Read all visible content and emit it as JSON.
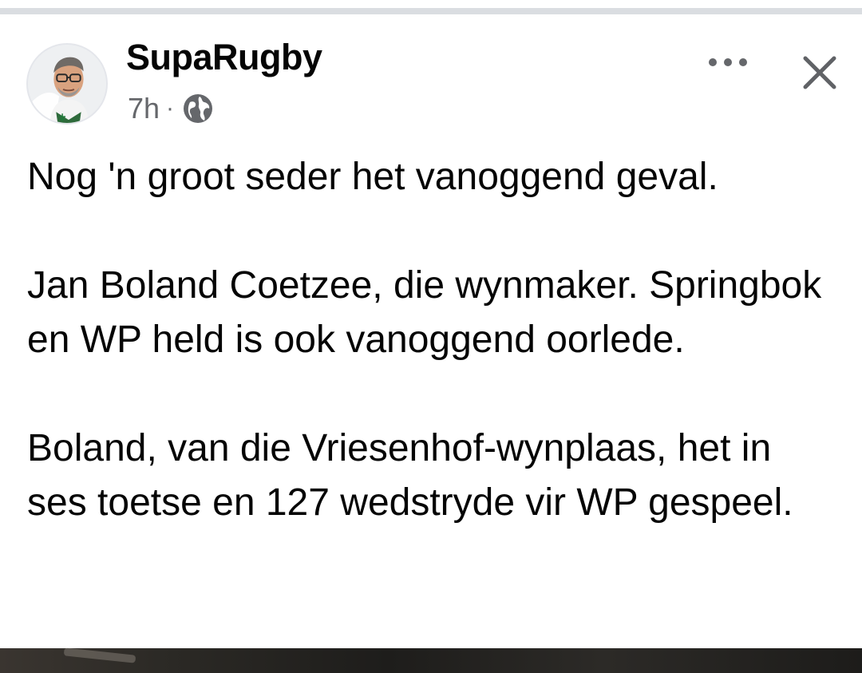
{
  "post": {
    "author": "SupaRugby",
    "time": "7h",
    "separator": "·",
    "privacy_icon": "globe-icon",
    "more_icon": "more-dots-icon",
    "close_icon": "close-icon",
    "avatar_icon": "profile-avatar",
    "paragraphs": [
      "Nog 'n groot seder het vanoggend geval.",
      "Jan Boland Coetzee, die wynmaker. Springbok en WP held is ook vanoggend oorlede.",
      "Boland, van die Vriesenhof-wynplaas, het in ses toetse en 127 wedstryde vir WP gespeel."
    ]
  },
  "colors": {
    "text_primary": "#050505",
    "text_secondary": "#65676b",
    "divider": "#dadde1",
    "background": "#ffffff"
  }
}
